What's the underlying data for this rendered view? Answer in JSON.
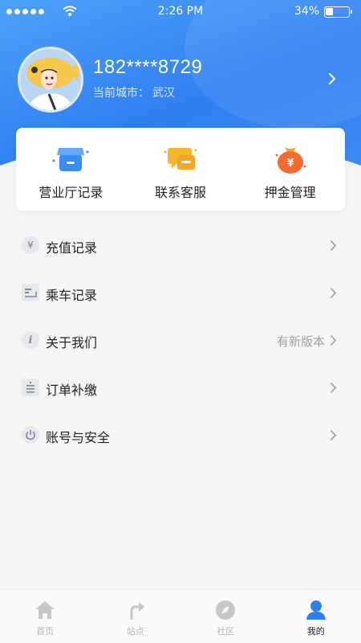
{
  "status_bar": {
    "time": "2:26 PM",
    "battery": "34%"
  },
  "profile": {
    "phone": "182****8729",
    "city_label": "当前城市：",
    "city": "武汉"
  },
  "quick_actions": [
    {
      "label": "营业厅记录",
      "icon": "store-icon"
    },
    {
      "label": "联系客服",
      "icon": "chat-icon"
    },
    {
      "label": "押金管理",
      "icon": "money-bag-icon"
    }
  ],
  "menu": [
    {
      "label": "充值记录",
      "icon": "yen-icon",
      "extra": ""
    },
    {
      "label": "乘车记录",
      "icon": "ride-record-icon",
      "extra": ""
    },
    {
      "label": "关于我们",
      "icon": "info-icon",
      "extra": "有新版本"
    },
    {
      "label": "订单补缴",
      "icon": "order-icon",
      "extra": ""
    },
    {
      "label": "账号与安全",
      "icon": "power-icon",
      "extra": ""
    }
  ],
  "tabs": [
    {
      "label": "首页",
      "icon": "home-icon",
      "active": false
    },
    {
      "label": "站点",
      "icon": "route-icon",
      "active": false
    },
    {
      "label": "社区",
      "icon": "compass-icon",
      "active": false
    },
    {
      "label": "我的",
      "icon": "user-icon",
      "active": true
    }
  ],
  "colors": {
    "primary": "#2f7ff2",
    "header_light": "#4ea1f8",
    "orange": "#f56b2d",
    "yellow": "#f8b62d",
    "gray_icon": "#7f8594"
  }
}
